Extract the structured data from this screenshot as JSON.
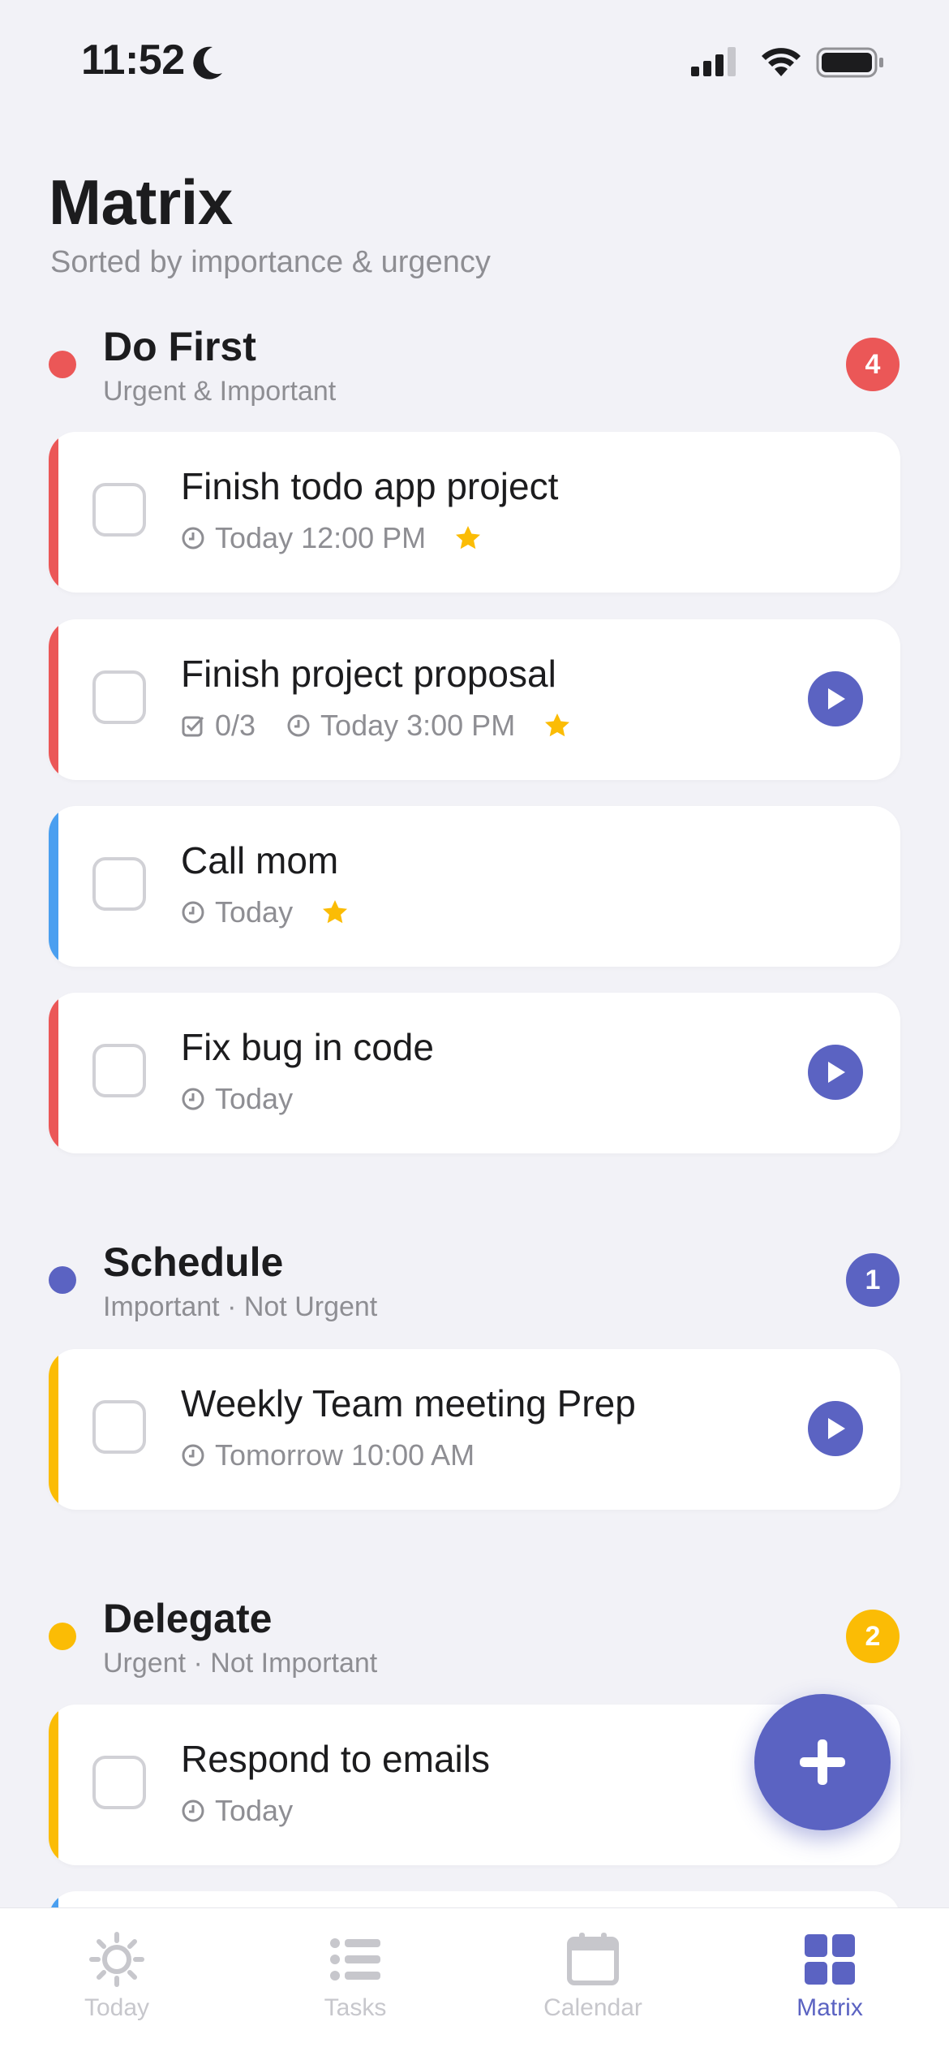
{
  "status_bar": {
    "time": "11:52",
    "icons": [
      "moon-icon",
      "cellular-signal-icon",
      "wifi-icon",
      "battery-icon"
    ]
  },
  "header": {
    "title": "Matrix",
    "subtitle": "Sorted by importance & urgency"
  },
  "colors": {
    "red": "#eb5757",
    "blue": "#5b63c2",
    "yellow": "#fbbc05",
    "light_blue": "#4a9ff0",
    "star": "#fbbc05",
    "accent": "#5b63c2",
    "tab_inactive": "#c7c7cc"
  },
  "sections": [
    {
      "title": "Do First",
      "subtitle": "Urgent & Important",
      "count": "4",
      "tasks": [
        {
          "title": "Finish todo app project",
          "due": "Today 12:00 PM",
          "starred": true,
          "has_play": false,
          "bar_color": "red"
        },
        {
          "title": "Finish project proposal",
          "subtasks": "0/3",
          "due": "Today 3:00 PM",
          "starred": true,
          "has_play": true,
          "bar_color": "red"
        },
        {
          "title": "Call mom",
          "due": "Today",
          "starred": true,
          "has_play": false,
          "bar_color": "light_blue"
        },
        {
          "title": "Fix bug in code",
          "due": "Today",
          "starred": false,
          "has_play": true,
          "bar_color": "red"
        }
      ]
    },
    {
      "title": "Schedule",
      "subtitle": "Important · Not Urgent",
      "count": "1",
      "tasks": [
        {
          "title": "Weekly Team meeting Prep",
          "due": "Tomorrow 10:00 AM",
          "starred": false,
          "has_play": true,
          "bar_color": "yellow"
        }
      ]
    },
    {
      "title": "Delegate",
      "subtitle": "Urgent · Not Important",
      "count": "2",
      "tasks": [
        {
          "title": "Respond to emails",
          "due": "Today",
          "starred": false,
          "has_play": false,
          "bar_color": "yellow"
        }
      ]
    }
  ],
  "fab": {
    "icon": "plus-icon"
  },
  "tab_bar": {
    "items": [
      {
        "label": "Today",
        "icon": "sun-icon",
        "active": false
      },
      {
        "label": "Tasks",
        "icon": "list-icon",
        "active": false
      },
      {
        "label": "Calendar",
        "icon": "calendar-icon",
        "active": false
      },
      {
        "label": "Matrix",
        "icon": "grid-icon",
        "active": true
      }
    ]
  }
}
